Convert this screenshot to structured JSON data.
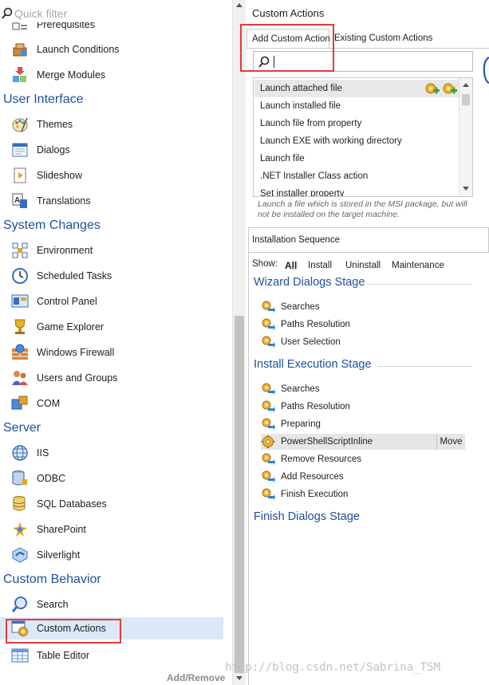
{
  "filter": {
    "placeholder": "Quick filter"
  },
  "nav": {
    "partial_top_item": "Prerequisites",
    "items_pre": [
      {
        "id": "launch-conditions",
        "label": "Launch Conditions",
        "icon": "launch-conditions-icon"
      },
      {
        "id": "merge-modules",
        "label": "Merge Modules",
        "icon": "merge-modules-icon"
      }
    ],
    "categories": {
      "user_interface": "User Interface",
      "system_changes": "System Changes",
      "server": "Server",
      "custom_behavior": "Custom Behavior"
    },
    "user_interface": [
      {
        "id": "themes",
        "label": "Themes",
        "icon": "palette-icon"
      },
      {
        "id": "dialogs",
        "label": "Dialogs",
        "icon": "dialogs-icon"
      },
      {
        "id": "slideshow",
        "label": "Slideshow",
        "icon": "slideshow-icon"
      },
      {
        "id": "translations",
        "label": "Translations",
        "icon": "translations-icon"
      }
    ],
    "system_changes": [
      {
        "id": "environment",
        "label": "Environment",
        "icon": "environment-icon"
      },
      {
        "id": "scheduled-tasks",
        "label": "Scheduled Tasks",
        "icon": "clock-icon"
      },
      {
        "id": "control-panel",
        "label": "Control Panel",
        "icon": "control-panel-icon"
      },
      {
        "id": "game-explorer",
        "label": "Game Explorer",
        "icon": "trophy-icon"
      },
      {
        "id": "windows-firewall",
        "label": "Windows Firewall",
        "icon": "firewall-icon"
      },
      {
        "id": "users-and-groups",
        "label": "Users and Groups",
        "icon": "users-icon"
      },
      {
        "id": "com",
        "label": "COM",
        "icon": "com-icon"
      }
    ],
    "server": [
      {
        "id": "iis",
        "label": "IIS",
        "icon": "globe-icon"
      },
      {
        "id": "odbc",
        "label": "ODBC",
        "icon": "database-plug-icon"
      },
      {
        "id": "sql-databases",
        "label": "SQL Databases",
        "icon": "database-icon"
      },
      {
        "id": "sharepoint",
        "label": "SharePoint",
        "icon": "sharepoint-icon"
      },
      {
        "id": "silverlight",
        "label": "Silverlight",
        "icon": "silverlight-icon"
      }
    ],
    "custom_behavior": [
      {
        "id": "search",
        "label": "Search",
        "icon": "search-icon"
      },
      {
        "id": "custom-actions",
        "label": "Custom Actions",
        "icon": "custom-actions-icon",
        "selected": true
      },
      {
        "id": "table-editor",
        "label": "Table Editor",
        "icon": "table-icon"
      }
    ],
    "add_remove": "Add/Remove"
  },
  "panel": {
    "title": "Custom Actions",
    "tabs": [
      {
        "label": "Add Custom Action",
        "active": true
      },
      {
        "label": "Existing Custom Actions",
        "active": false
      }
    ],
    "search_value": "",
    "actions": [
      "Launch attached file",
      "Launch installed file",
      "Launch file from property",
      "Launch EXE with working directory",
      "Launch file",
      ".NET Installer Class action",
      "Set installer property"
    ],
    "description": "Launch a file which is stored in the MSI package, but will not be installed on the target machine."
  },
  "sequence": {
    "header": "Installation Sequence",
    "show_label": "Show:",
    "show_options": [
      {
        "label": "All",
        "active": true
      },
      {
        "label": "Install",
        "active": false
      },
      {
        "label": "Uninstall",
        "active": false
      },
      {
        "label": "Maintenance",
        "active": false
      }
    ],
    "stages": [
      {
        "title": "Wizard Dialogs Stage",
        "items": [
          "Searches",
          "Paths Resolution",
          "User Selection"
        ]
      },
      {
        "title": "Install Execution Stage",
        "items": [
          "Searches",
          "Paths Resolution",
          "Preparing",
          "PowerShellScriptInline",
          "Remove Resources",
          "Add Resources",
          "Finish Execution"
        ]
      },
      {
        "title": "Finish Dialogs Stage",
        "items": []
      }
    ],
    "move_label": "Move"
  },
  "watermark": "http://blog.csdn.net/Sabrina_TSM",
  "colors": {
    "category": "#1f4f9e",
    "selection": "#dbe8f8",
    "highlight_box": "#e43a3a"
  }
}
